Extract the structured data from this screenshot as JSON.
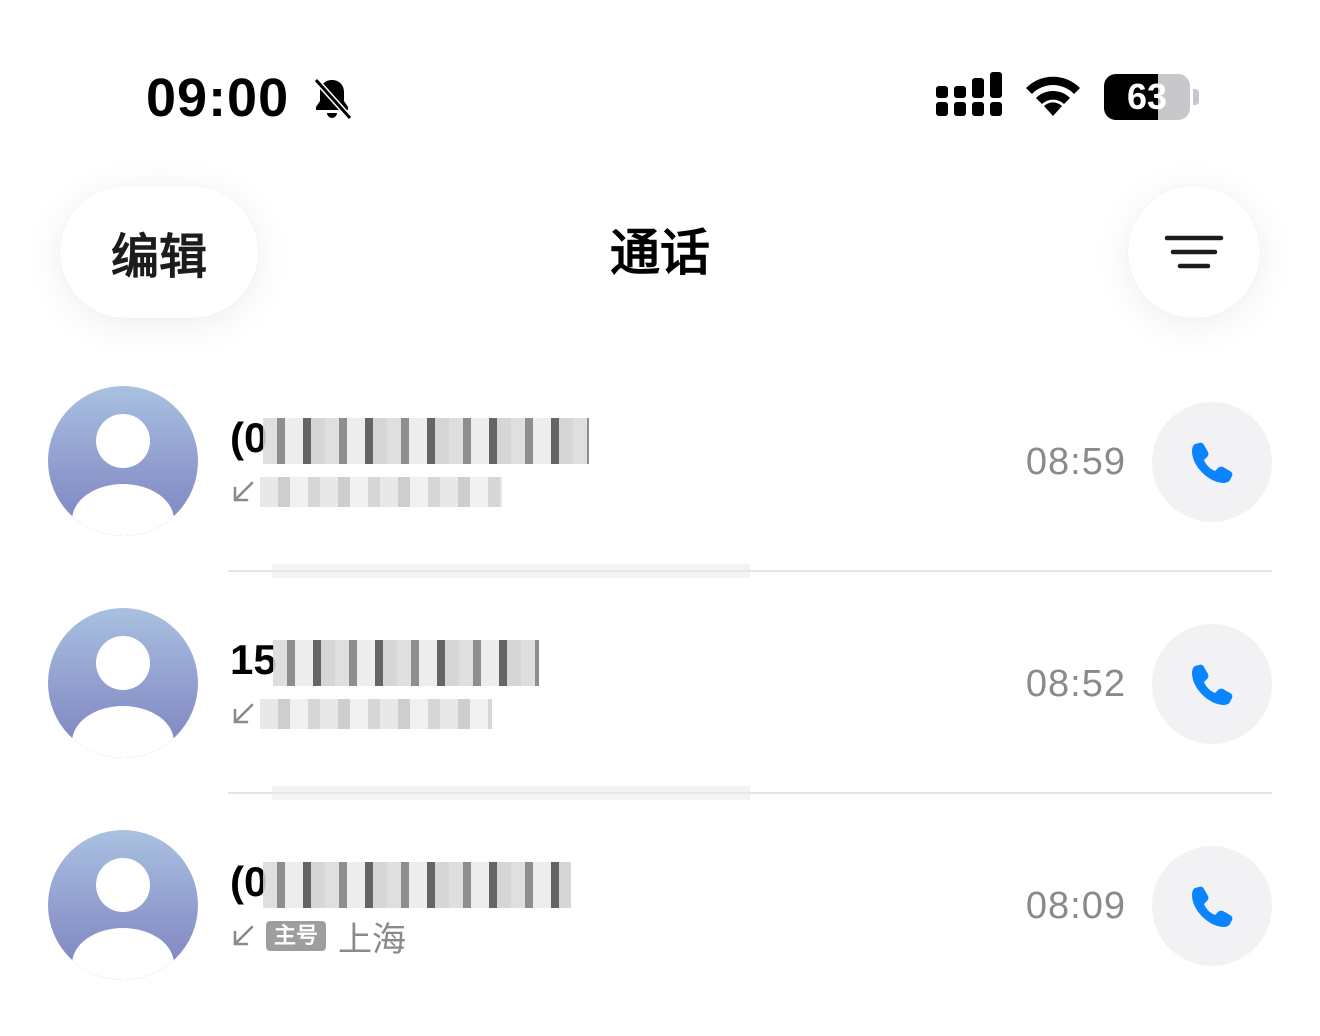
{
  "status_bar": {
    "time": "09:00",
    "silent_icon": "bell-off-icon",
    "signal_icon": "signal-icon",
    "wifi_icon": "wifi-icon",
    "battery_percent": "63",
    "battery_level": 0.63
  },
  "nav": {
    "edit_label": "编辑",
    "title": "通话",
    "filter_icon": "filter-lines-icon"
  },
  "calls": [
    {
      "name": "(0",
      "direction_icon": "incoming-arrow-icon",
      "badge": "",
      "location": "",
      "time": "08:59",
      "action_icon": "phone-icon"
    },
    {
      "name": "15",
      "direction_icon": "incoming-arrow-icon",
      "badge": "",
      "location": "",
      "time": "08:52",
      "action_icon": "phone-icon"
    },
    {
      "name": "(0",
      "direction_icon": "incoming-arrow-icon",
      "badge": "主号",
      "location": "上海",
      "time": "08:09",
      "action_icon": "phone-icon"
    }
  ],
  "colors": {
    "accent": "#0a84ff",
    "secondary_text": "#8a8a8e",
    "avatar_top": "#a9c1e1",
    "avatar_bottom": "#7c84c0"
  }
}
